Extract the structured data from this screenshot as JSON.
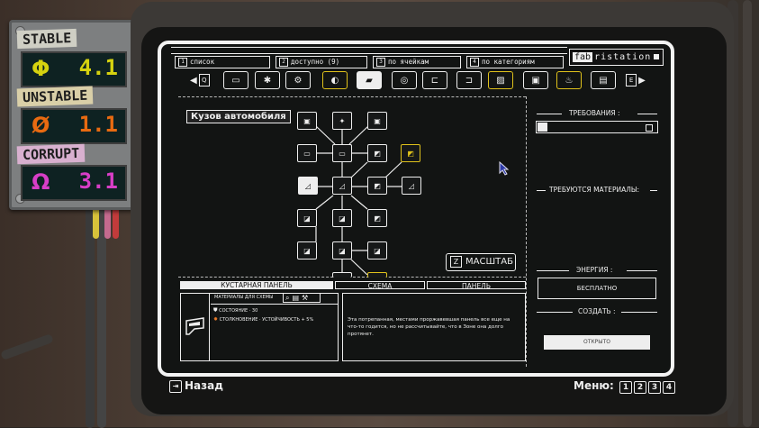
{
  "stats": [
    {
      "label": "STABLE",
      "symbol": "Φ",
      "value": "4.1",
      "color": "#d6d20f",
      "label_bg": "#cfcfc4"
    },
    {
      "label": "UNSTABLE",
      "symbol": "Ø",
      "value": "1.1",
      "color": "#e86a11",
      "label_bg": "#d9cfa8"
    },
    {
      "label": "CORRUPT",
      "symbol": "Ω",
      "value": "3.1",
      "color": "#d83ec7",
      "label_bg": "#d8b0cf"
    }
  ],
  "brand": {
    "prefix": "fab",
    "name": "ristation"
  },
  "category_tabs": [
    {
      "key": "1",
      "label": "список"
    },
    {
      "key": "2",
      "label": "доступно (9)"
    },
    {
      "key": "3",
      "label": "по ячейкам"
    },
    {
      "key": "4",
      "label": "по категориям"
    }
  ],
  "nav_keys": {
    "left": "Q",
    "right": "E"
  },
  "tree_label": "Кузов автомобиля",
  "zoom_button": {
    "key": "Z",
    "label": "МАСШТАБ"
  },
  "bottom_tabs": [
    "КУСТАРНАЯ ПАНЕЛЬ",
    "СХЕМА",
    "ПАНЕЛЬ"
  ],
  "materials_header": "МАТЕРИАЛЫ ДЛЯ СХЕМЫ",
  "item_stats": [
    {
      "icon": "shield-icon",
      "text": "СОСТОЯНИЕ · 30"
    },
    {
      "icon": "impact-icon",
      "text": "СТОЛКНОВЕНИЕ · УСТОЙЧИВОСТЬ + 5%"
    }
  ],
  "description": "Эта потрепанная, местами проржавевшая панель все еще на что-то годится, но не рассчитывайте, что в Зоне она долго протянет.",
  "right_panel": {
    "requirements": "ТРЕБОВАНИЯ :",
    "materials_needed": "ТРЕБУЮТСЯ МАТЕРИАЛЫ:",
    "energy_label": "ЭНЕРГИЯ :",
    "energy_value": "БЕСПЛАТНО",
    "create_label": "СОЗДАТЬ :",
    "open_button": "ОТКРЫТО"
  },
  "footer": {
    "back_label": "Назад",
    "menu_label": "Меню:",
    "menu_keys": [
      "1",
      "2",
      "3",
      "4"
    ]
  },
  "colors": {
    "accent_yellow": "#e0c21b",
    "screen_bg": "#121413",
    "ink": "#f2f2f2"
  }
}
